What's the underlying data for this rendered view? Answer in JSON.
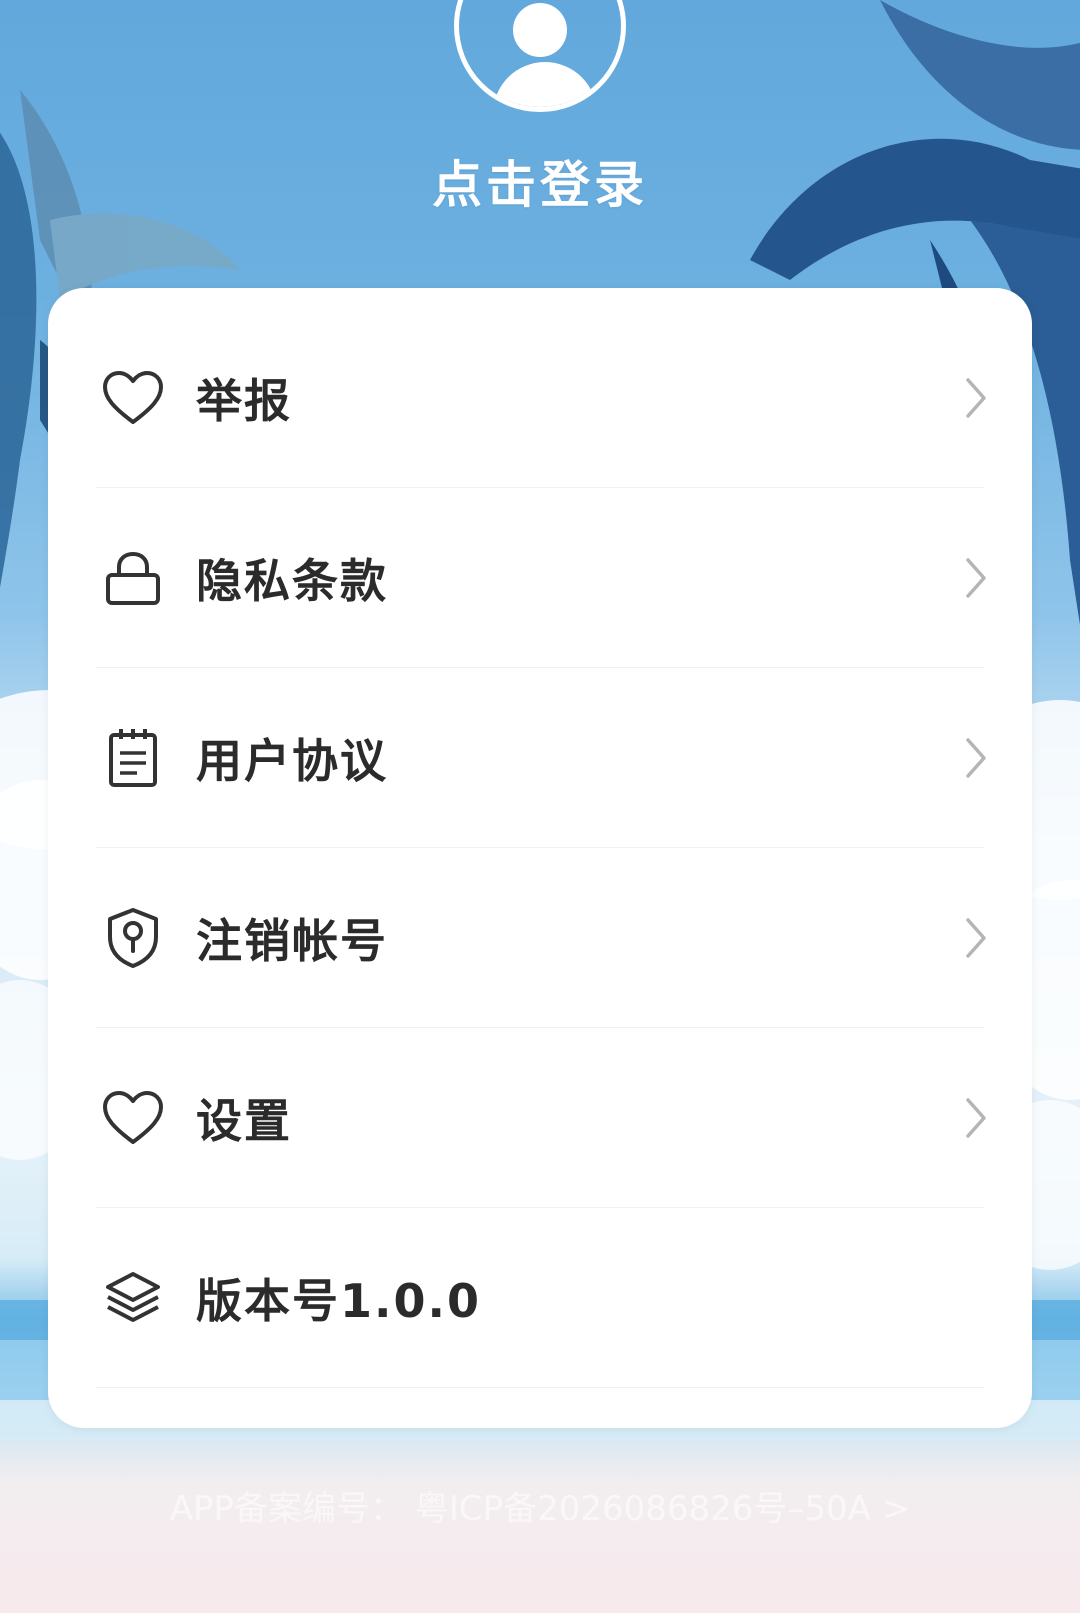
{
  "header": {
    "login_label": "点击登录"
  },
  "menu": {
    "items": [
      {
        "label": "举报",
        "icon": "heart-icon",
        "chevron": true
      },
      {
        "label": "隐私条款",
        "icon": "lock-icon",
        "chevron": true
      },
      {
        "label": "用户协议",
        "icon": "notepad-icon",
        "chevron": true
      },
      {
        "label": "注销帐号",
        "icon": "shield-key-icon",
        "chevron": true
      },
      {
        "label": "设置",
        "icon": "heart-icon",
        "chevron": true
      },
      {
        "label": "版本号1.0.0",
        "icon": "layers-icon",
        "chevron": false
      }
    ]
  },
  "footer": {
    "icp_text": "APP备案编号：  粤ICP备2026086826号–50A >"
  },
  "colors": {
    "sky": "#62a8dc",
    "card": "#ffffff",
    "text": "#2b2b2b",
    "chevron": "#b5b5b5",
    "icon": "#333333"
  }
}
